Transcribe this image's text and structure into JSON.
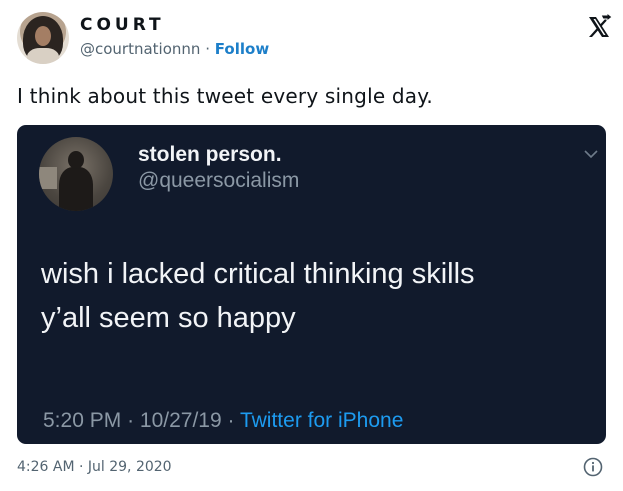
{
  "author": {
    "display_name": "COURT",
    "handle": "@courtnationnn",
    "separator": "·",
    "follow_label": "Follow"
  },
  "tweet": {
    "text": "I think about this tweet every single day.",
    "timestamp": "4:26 AM · Jul 29, 2020"
  },
  "embedded": {
    "name": "stolen person.",
    "handle": "@queersocialism",
    "line1": "wish i lacked critical thinking skills",
    "line2": "y’all seem so happy",
    "time": "5:20 PM",
    "date": "10/27/19",
    "sep": "·",
    "source": "Twitter for iPhone"
  },
  "icons": {
    "brand": "x-logo-icon",
    "info": "info-icon",
    "chevron": "chevron-down-icon"
  },
  "colors": {
    "link": "#1d7fc9",
    "embed_bg": "#111a2c",
    "source_blue": "#1d9bf0",
    "meta_gray": "#8b98a5"
  }
}
